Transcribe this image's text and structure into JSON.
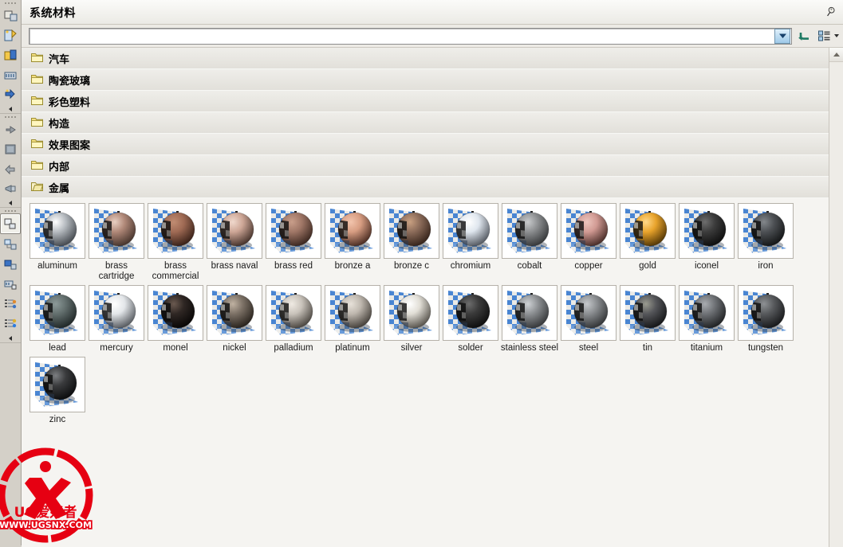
{
  "window": {
    "title": "系统材料",
    "pin_icon": "pushpin-icon"
  },
  "search": {
    "value": "",
    "placeholder": "",
    "dropdown_icon": "chevron-down-icon",
    "back_button_icon": "undo-arrow-icon",
    "view_button_icon": "list-view-icon",
    "view_menu_icon": "caret-down-icon"
  },
  "left_toolbar": {
    "groups": [
      {
        "name": "group-1",
        "buttons": [
          {
            "icon": "assign-material-icon",
            "selected": false
          },
          {
            "icon": "edit-material-icon",
            "selected": false
          },
          {
            "icon": "new-material-icon",
            "selected": false
          },
          {
            "icon": "material-library-icon",
            "selected": false
          },
          {
            "icon": "apply-material-icon",
            "selected": false
          }
        ]
      },
      {
        "name": "group-2",
        "buttons": [
          {
            "icon": "pointer-hand-icon",
            "selected": false
          },
          {
            "icon": "texture-swatch-icon",
            "selected": false
          },
          {
            "icon": "flip-arrows-icon",
            "selected": false
          },
          {
            "icon": "spotlight-icon",
            "selected": false
          }
        ]
      },
      {
        "name": "group-3",
        "buttons": [
          {
            "icon": "part-navigator-icon",
            "selected": true
          },
          {
            "icon": "assembly-navigator-icon",
            "selected": false
          },
          {
            "icon": "constraint-navigator-icon",
            "selected": false
          },
          {
            "icon": "reuse-library-icon",
            "selected": false
          },
          {
            "icon": "history-list-icon",
            "selected": false
          },
          {
            "icon": "role-list-icon",
            "selected": false
          }
        ]
      }
    ]
  },
  "folders": [
    {
      "label": "汽车",
      "open": false
    },
    {
      "label": "陶瓷玻璃",
      "open": false
    },
    {
      "label": "彩色塑料",
      "open": false
    },
    {
      "label": "构造",
      "open": false
    },
    {
      "label": "效果图案",
      "open": false
    },
    {
      "label": "内部",
      "open": false
    },
    {
      "label": "金属",
      "open": true
    }
  ],
  "materials": [
    {
      "label": "aluminum",
      "base": "#b6bbc0",
      "hi": "#ffffff",
      "dark": "#4a4f55"
    },
    {
      "label": "brass cartridge",
      "base": "#b08878",
      "hi": "#e8cfc2",
      "dark": "#4b3830"
    },
    {
      "label": "brass commercial",
      "base": "#9f6a54",
      "hi": "#c08c72",
      "dark": "#3d241b"
    },
    {
      "label": "brass naval",
      "base": "#cda696",
      "hi": "#f0d9cd",
      "dark": "#4c3830"
    },
    {
      "label": "brass red",
      "base": "#a07767",
      "hi": "#c99e8a",
      "dark": "#402b23"
    },
    {
      "label": "bronze a",
      "base": "#d79d82",
      "hi": "#f2c4ad",
      "dark": "#513227"
    },
    {
      "label": "bronze c",
      "base": "#8d6d5b",
      "hi": "#c9a081",
      "dark": "#39271e"
    },
    {
      "label": "chromium",
      "base": "#dfe6ee",
      "hi": "#ffffff",
      "dark": "#5b6068"
    },
    {
      "label": "cobalt",
      "base": "#8d8f91",
      "hi": "#c9cbcd",
      "dark": "#3a3c3e"
    },
    {
      "label": "copper",
      "base": "#d19a93",
      "hi": "#edc5bd",
      "dark": "#4f322d"
    },
    {
      "label": "gold",
      "base": "#e8a32b",
      "hi": "#ffd98a",
      "dark": "#5a3c08"
    },
    {
      "label": "iconel",
      "base": "#3c3c3c",
      "hi": "#6e6e6e",
      "dark": "#101010"
    },
    {
      "label": "iron",
      "base": "#4d5054",
      "hi": "#83878b",
      "dark": "#161819"
    },
    {
      "label": "lead",
      "base": "#636f6e",
      "hi": "#8d9a99",
      "dark": "#232b2b"
    },
    {
      "label": "mercury",
      "base": "#e3e6e9",
      "hi": "#ffffff",
      "dark": "#5e6267"
    },
    {
      "label": "monel",
      "base": "#2f2724",
      "hi": "#6b5a50",
      "dark": "#0a0807"
    },
    {
      "label": "nickel",
      "base": "#7c7166",
      "hi": "#c0b2a2",
      "dark": "#2c2620"
    },
    {
      "label": "palladium",
      "base": "#c9c3bb",
      "hi": "#efeae3",
      "dark": "#514c46"
    },
    {
      "label": "platinum",
      "base": "#bfb8af",
      "hi": "#e7e1d9",
      "dark": "#4b4640"
    },
    {
      "label": "silver",
      "base": "#e1ded6",
      "hi": "#ffffff",
      "dark": "#5e5a53"
    },
    {
      "label": "solder",
      "base": "#3b3b3b",
      "hi": "#6d6d6d",
      "dark": "#101010"
    },
    {
      "label": "stainless steel",
      "base": "#8e9194",
      "hi": "#cfd2d5",
      "dark": "#3a3c3e"
    },
    {
      "label": "steel",
      "base": "#8b8e91",
      "hi": "#c6c9cc",
      "dark": "#37393b"
    },
    {
      "label": "tin",
      "base": "#55565a",
      "hi": "#9a9b8f",
      "dark": "#18191b"
    },
    {
      "label": "titanium",
      "base": "#6f7276",
      "hi": "#a9acb0",
      "dark": "#232527"
    },
    {
      "label": "tungsten",
      "base": "#57595c",
      "hi": "#8e9194",
      "dark": "#1a1b1d"
    },
    {
      "label": "zinc",
      "base": "#3a3b3d",
      "hi": "#7d7f82",
      "dark": "#0e0f10"
    }
  ],
  "watermark": {
    "brand": "UG爱好者",
    "url": "WWW.UGSNX.COM"
  },
  "colors": {
    "panel_bg": "#f5f4f1",
    "rail_bg": "#d4d0c8",
    "folder_row": "#e8e6e1",
    "accent_blue": "#3f7fd0",
    "watermark_red": "#e60012"
  }
}
